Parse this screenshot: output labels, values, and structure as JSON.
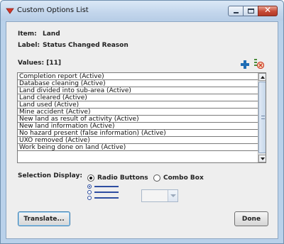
{
  "window": {
    "title": "Custom Options List",
    "controls": {
      "minimize": "minimize",
      "maximize": "maximize",
      "close": "x"
    }
  },
  "item": {
    "label": "Item:",
    "value": "Land"
  },
  "label_field": {
    "label": "Label:",
    "value": "Status Changed Reason"
  },
  "values": {
    "header": "Values: [11]",
    "items": [
      "Completion report (Active)",
      "Database cleaning (Active)",
      "Land divided into sub-area (Active)",
      "Land cleared (Active)",
      "Land used (Active)",
      "Mine accident (Active)",
      "New land as result of activity (Active)",
      "New land information (Active)",
      "No hazard present (false information) (Active)",
      "UXO removed (Active)",
      "Work being done on land (Active)"
    ]
  },
  "selection_display": {
    "label": "Selection Display:",
    "options": [
      "Radio Buttons",
      "Combo Box"
    ],
    "selected": "Radio Buttons"
  },
  "buttons": {
    "translate": "Translate...",
    "done": "Done"
  },
  "icons": {
    "app": "red-chevron-icon",
    "add": "add-plus-icon",
    "remove": "remove-icon"
  },
  "colors": {
    "titlebar": "#c3d6ec",
    "close_button": "#c74a36",
    "add_icon": "#1f6db5",
    "remove_icon": "#d23a2a",
    "preview_accent": "#2e4ea1"
  }
}
